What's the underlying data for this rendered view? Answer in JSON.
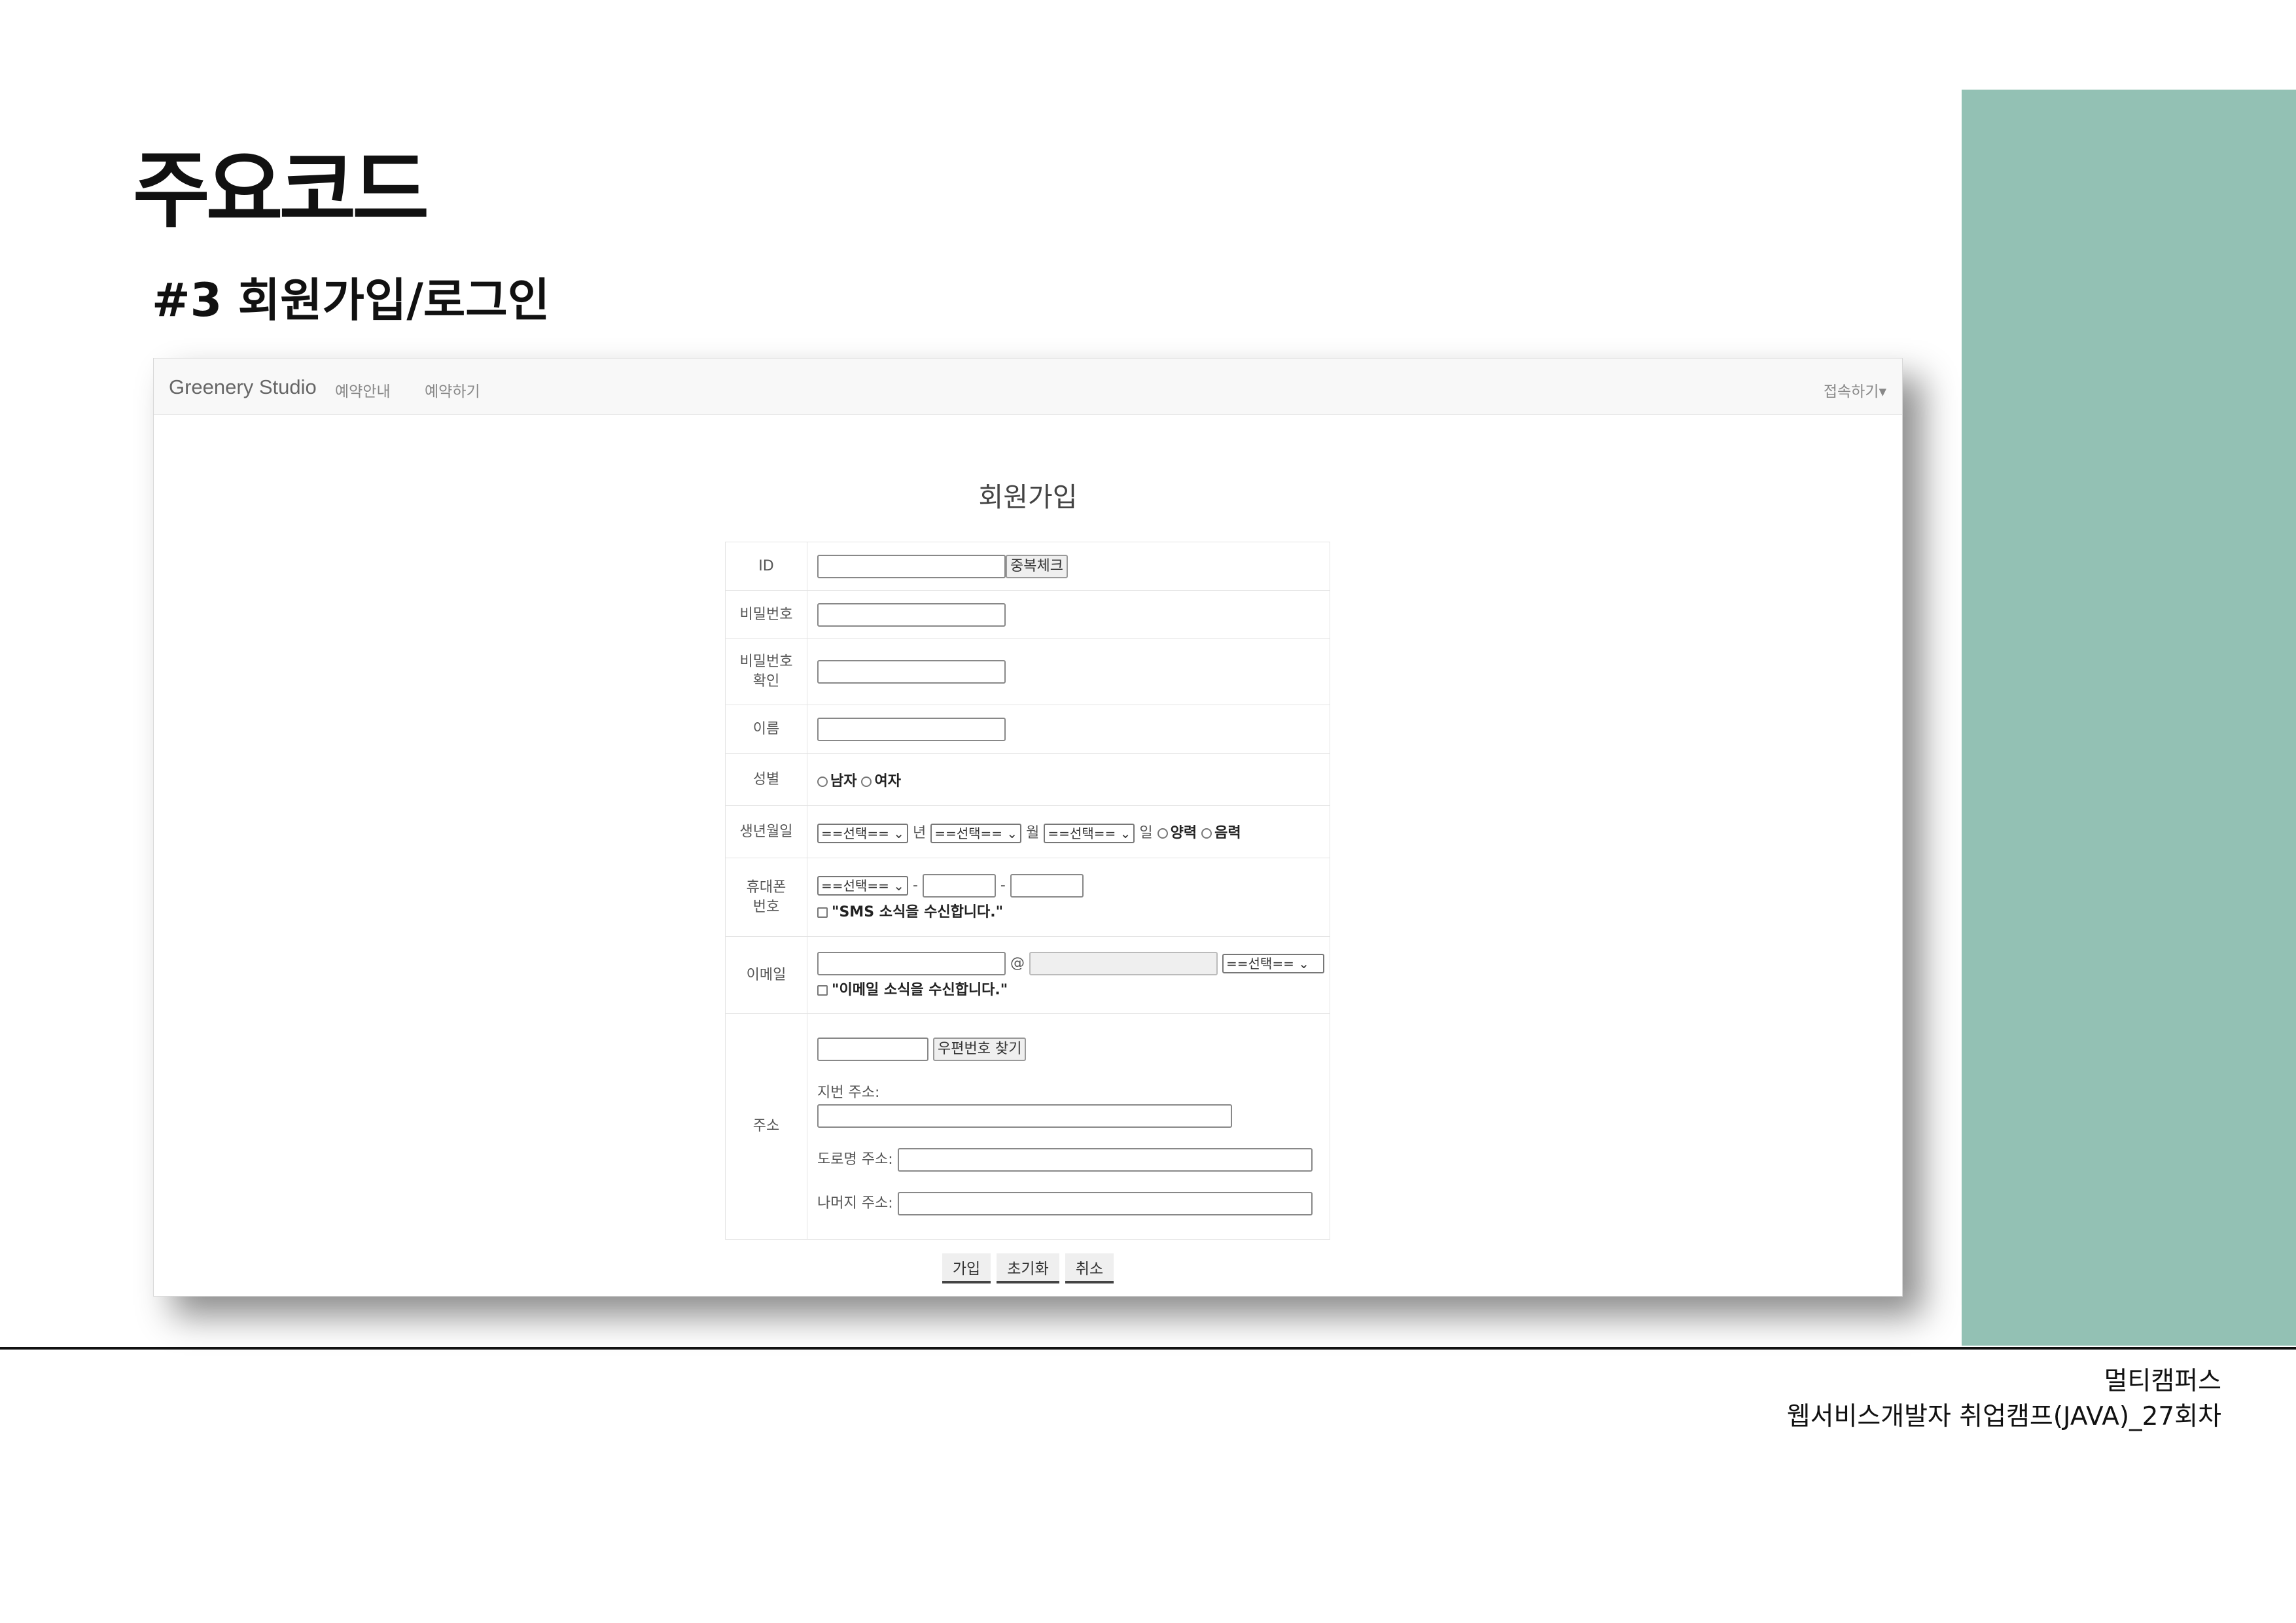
{
  "slide": {
    "title": "주요코드",
    "subtitle": "#3 회원가입/로그인",
    "footer_line1": "멀티캠퍼스",
    "footer_line2": "웹서비스개발자 취업캠프(JAVA)_27회차",
    "accent_color": "#93c1b4"
  },
  "navbar": {
    "brand": "Greenery Studio",
    "link1": "예약안내",
    "link2": "예약하기",
    "right": "접속하기▾"
  },
  "form": {
    "title": "회원가입",
    "id_label": "ID",
    "dup_check": "중복체크",
    "pw_label": "비밀번호",
    "pw_confirm_label1": "비밀번호",
    "pw_confirm_label2": "확인",
    "name_label": "이름",
    "gender_label": "성별",
    "male": "남자",
    "female": "여자",
    "birth_label": "생년월일",
    "select": "==선택== ⌄",
    "year": "년",
    "month": "월",
    "day": "일",
    "solar": "양력",
    "lunar": "음력",
    "phone_label1": "휴대폰",
    "phone_label2": "번호",
    "dash": "-",
    "sms_consent": "\"SMS 소식을 수신합니다.\"",
    "email_label": "이메일",
    "at": "@",
    "email_select": "==선택==   ⌄",
    "email_consent": "\"이메일 소식을 수신합니다.\"",
    "addr_label": "주소",
    "zip_button": "우편번호 찾기",
    "jibun": "지번 주소:",
    "road": "도로명 주소:",
    "rest": "나머지 주소:",
    "submit": "가입",
    "reset": "초기화",
    "cancel": "취소"
  }
}
